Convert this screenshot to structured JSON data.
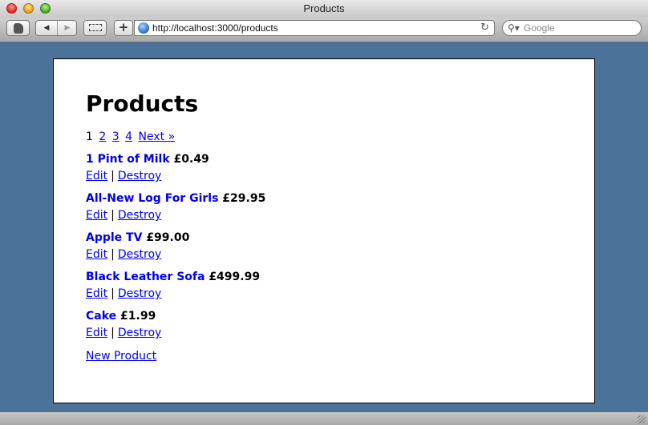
{
  "window": {
    "title": "Products"
  },
  "toolbar": {
    "url": "http://localhost:3000/products",
    "search_placeholder": "Google"
  },
  "page": {
    "heading": "Products",
    "pagination": {
      "current": "1",
      "pages": [
        "2",
        "3",
        "4"
      ],
      "next": "Next »"
    },
    "products": [
      {
        "name": "1 Pint of Milk",
        "price": "£0.49"
      },
      {
        "name": "All-New Log For Girls",
        "price": "£29.95"
      },
      {
        "name": "Apple TV",
        "price": "£99.00"
      },
      {
        "name": "Black Leather Sofa",
        "price": "£499.99"
      },
      {
        "name": "Cake",
        "price": "£1.99"
      }
    ],
    "edit_label": "Edit",
    "destroy_label": "Destroy",
    "separator": "|",
    "new_product": "New Product"
  },
  "colors": {
    "link": "#0000ee",
    "desktop": "#4b7399"
  }
}
